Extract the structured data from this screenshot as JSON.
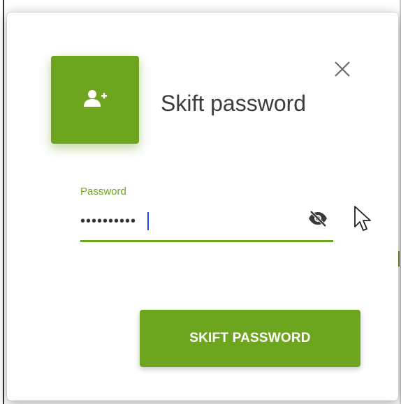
{
  "dialog": {
    "title": "Skift password",
    "close_label": "×"
  },
  "form": {
    "password_label": "Password",
    "password_value": "••••••••••",
    "submit_label": "SKIFT PASSWORD"
  },
  "icons": {
    "header": "add-user-icon",
    "close": "close-icon",
    "visibility": "visibility-off-icon",
    "cursor": "mouse-cursor-icon"
  },
  "colors": {
    "accent": "#6ea51f",
    "title_text": "#3c3c3c",
    "input_caret": "#1d4ed8"
  }
}
